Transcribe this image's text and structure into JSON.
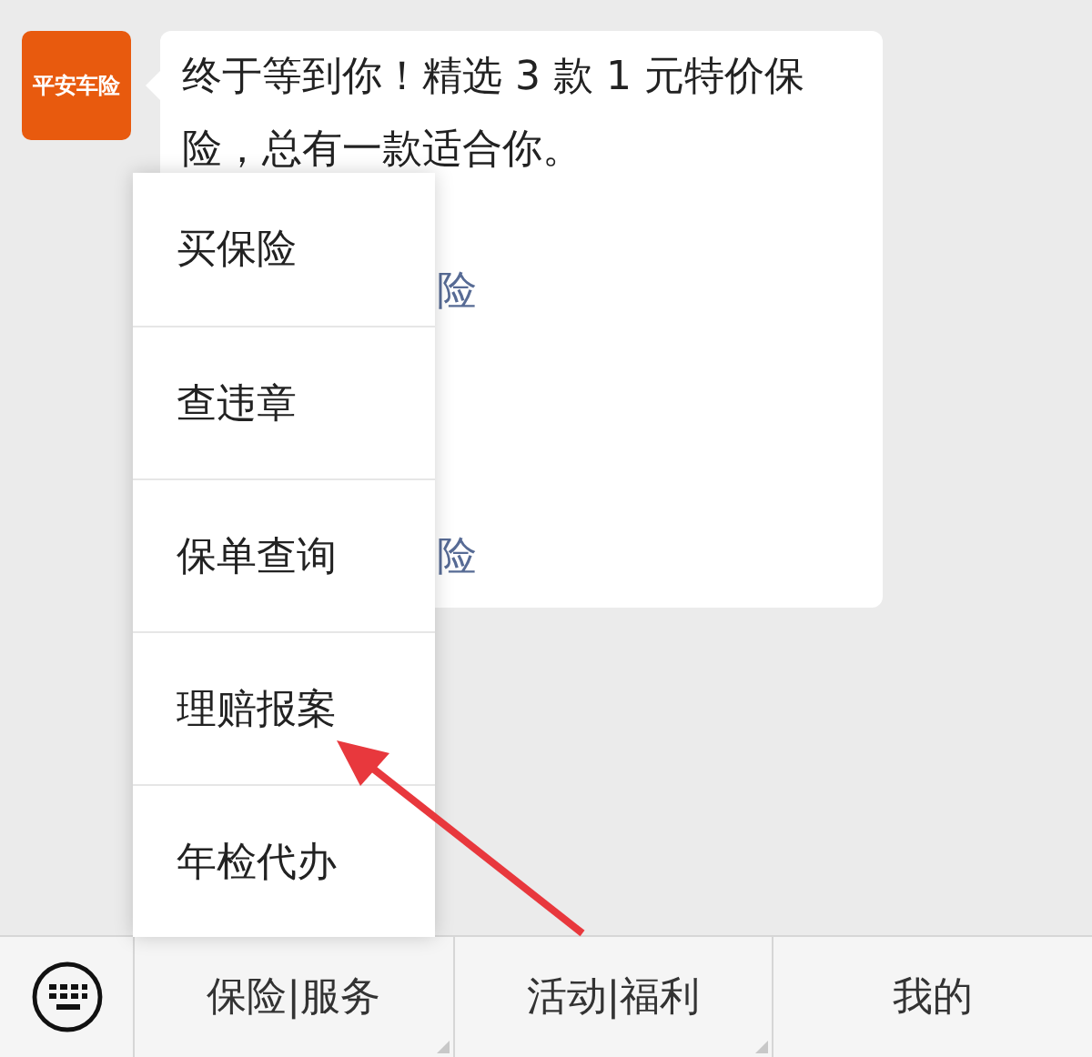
{
  "chat": {
    "sender_logo": "平安车险",
    "message": "终于等到你！精选 3 款 1 元特价保险，总有一款适合你。",
    "links": [
      "险",
      "险"
    ]
  },
  "popup_menu": {
    "items": [
      "买保险",
      "查违章",
      "保单查询",
      "理赔报案",
      "年检代办"
    ]
  },
  "bottom_menu": [
    {
      "label": "保险|服务",
      "submenu": true
    },
    {
      "label": "活动|福利",
      "submenu": true
    },
    {
      "label": "我的",
      "submenu": false
    }
  ]
}
